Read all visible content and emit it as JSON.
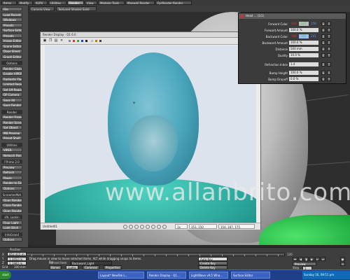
{
  "top_tabs": [
    "Items",
    "Modify",
    "XLPX",
    "Utilities",
    "Render",
    "View",
    "Modeler Tools",
    "Maxwell Render",
    "FprRender Render"
  ],
  "active_tab": "Render",
  "viewport_bar": {
    "view_mode": "Camera View",
    "shading": "Textured Shaded Solid"
  },
  "left_toolbar": [
    {
      "label": "File",
      "header": false
    },
    {
      "label": "Load Recent",
      "header": false
    },
    {
      "label": "Windows",
      "header": false
    },
    {
      "label": "Presets",
      "header": false
    },
    {
      "label": "Surface Editor",
      "header": false
    },
    {
      "label": "Presets",
      "header": false
    },
    {
      "label": "Image Editor",
      "header": false
    },
    {
      "label": "Scene Editor",
      "header": false
    },
    {
      "label": "Dope Sheet",
      "header": false
    },
    {
      "label": "Graph Editor",
      "header": false
    },
    {
      "label": "Options",
      "header": true
    },
    {
      "label": "Render Globals",
      "header": false
    },
    {
      "label": "Enable VIPER",
      "header": false
    },
    {
      "label": "Radiosity Flags",
      "header": false
    },
    {
      "label": "Limited Region",
      "header": false
    },
    {
      "label": "Set LM Region",
      "header": false
    },
    {
      "label": "DP Camera",
      "header": false
    },
    {
      "label": "Save All",
      "header": false
    },
    {
      "label": "Save Render S...",
      "header": false
    },
    {
      "label": "Render",
      "header": true
    },
    {
      "label": "Render Frame",
      "header": false
    },
    {
      "label": "Render Scene",
      "header": false
    },
    {
      "label": "Set Object",
      "header": false
    },
    {
      "label": "MB Preview",
      "header": false
    },
    {
      "label": "Preset Shelf",
      "header": false
    },
    {
      "label": "Utilities",
      "header": true
    },
    {
      "label": "VIPER",
      "header": false
    },
    {
      "label": "Network Render",
      "header": false
    },
    {
      "label": "FPrime 2.0",
      "header": true
    },
    {
      "label": "Preview",
      "header": false
    },
    {
      "label": "Refresh",
      "header": false
    },
    {
      "label": "Pause",
      "header": false
    },
    {
      "label": "Render to Disk",
      "header": false
    },
    {
      "label": "Options",
      "header": false
    },
    {
      "label": "ScreamerNet",
      "header": true
    },
    {
      "label": "Open Render-G",
      "header": false
    },
    {
      "label": "Close Render-G",
      "header": false
    },
    {
      "label": "Open Render-S",
      "header": false
    },
    {
      "label": "sRL Lookin",
      "header": true
    },
    {
      "label": "Floor Light",
      "header": false
    },
    {
      "label": "Light Bitch",
      "header": false
    },
    {
      "label": "InfoGrand",
      "header": true
    },
    {
      "label": "Options",
      "header": false
    }
  ],
  "render_window": {
    "title": "Render Display - Q1 6.0",
    "status_name": "Untitled01",
    "status_size": "1x",
    "status_coords": "351, 150",
    "status_rgb": "154, 167, 175"
  },
  "watermark": "www.allanbrito.com",
  "surface_panel": {
    "title": "Head ... (1/1)",
    "rows": [
      {
        "label": "Forward Color",
        "value": "",
        "swatch": "#bcbcbc",
        "v": [
          "233",
          "127",
          "150"
        ]
      },
      {
        "label": "Forward Amount",
        "value": "100.0 %"
      },
      {
        "label": "Backward Color",
        "value": "",
        "swatch": "#9fbcff",
        "v": [
          "160",
          "191",
          "241"
        ]
      },
      {
        "label": "Backward Amount",
        "value": "100.0 %"
      },
      {
        "label": "Distance",
        "value": "500 mm"
      },
      {
        "label": "Quality",
        "value": "10.0 %"
      },
      {
        "label": "Refraction Index",
        "value": "1.4"
      },
      {
        "label": "Bump Height",
        "value": "100.0 %"
      },
      {
        "label": "Bump Dropoff",
        "value": "0.0 %"
      }
    ]
  },
  "bottom": {
    "position_label": "Position",
    "x_value": "852.415 m",
    "y_value": "1.3452 m",
    "z_value": "1.1982 m",
    "grid_label": "Grid",
    "grid_value": "100 mm",
    "hint": "Drag mouse in view to move selected items. ALT while dragging snaps to items.",
    "current_item_label": "Current Item",
    "current_item_value": "Backward_Light",
    "bones_label": "Bones",
    "lights_label": "Lights",
    "cameras_label": "Cameras",
    "properties_label": "Properties",
    "autokey_label": "Auto Key",
    "create_key_label": "Create Key",
    "delete_key_label": "Delete Key",
    "frame_start": "0",
    "frame_end": "120",
    "preview_label": "Preview",
    "step_label": "Step",
    "step_value": "1",
    "sel_label": "Sel",
    "sel_value": "1"
  },
  "taskbar": {
    "start": "start",
    "tasks": [
      "Layout* NewTek L...",
      "Render Display - Q1...",
      "LightWave v9.5 Wha...",
      "Surface Editor"
    ],
    "tray_time": "Sunday 16, 09:51 pm"
  }
}
